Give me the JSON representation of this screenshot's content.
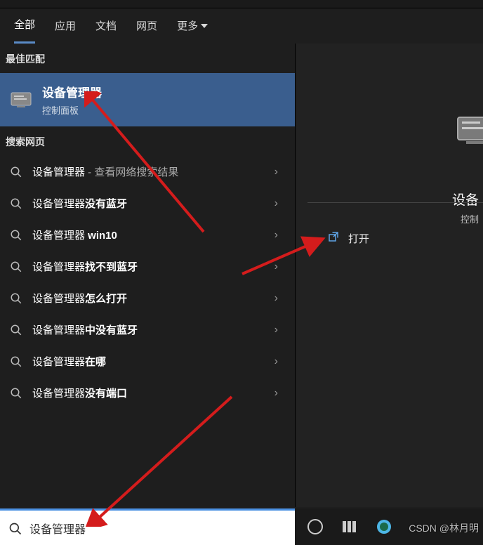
{
  "tabs": {
    "all": "全部",
    "apps": "应用",
    "docs": "文档",
    "web": "网页",
    "more": "更多"
  },
  "left": {
    "best_header": "最佳匹配",
    "best_title": "设备管理器",
    "best_sub": "控制面板",
    "web_header": "搜索网页",
    "results": [
      {
        "prefix": "设备管理器",
        "suffix": " - 查看网络搜索结果",
        "bold_suffix": false
      },
      {
        "prefix": "设备管理器",
        "suffix": "没有蓝牙",
        "bold_suffix": true
      },
      {
        "prefix": "设备管理器 ",
        "suffix": "win10",
        "bold_suffix": true
      },
      {
        "prefix": "设备管理器",
        "suffix": "找不到蓝牙",
        "bold_suffix": true
      },
      {
        "prefix": "设备管理器",
        "suffix": "怎么打开",
        "bold_suffix": true
      },
      {
        "prefix": "设备管理器",
        "suffix": "中没有蓝牙",
        "bold_suffix": true
      },
      {
        "prefix": "设备管理器",
        "suffix": "在哪",
        "bold_suffix": true
      },
      {
        "prefix": "设备管理器",
        "suffix": "没有端口",
        "bold_suffix": true
      }
    ]
  },
  "right": {
    "title": "设备",
    "sub": "控制",
    "open": "打开"
  },
  "search": {
    "value": "设备管理器"
  },
  "watermark": "CSDN @林月明"
}
